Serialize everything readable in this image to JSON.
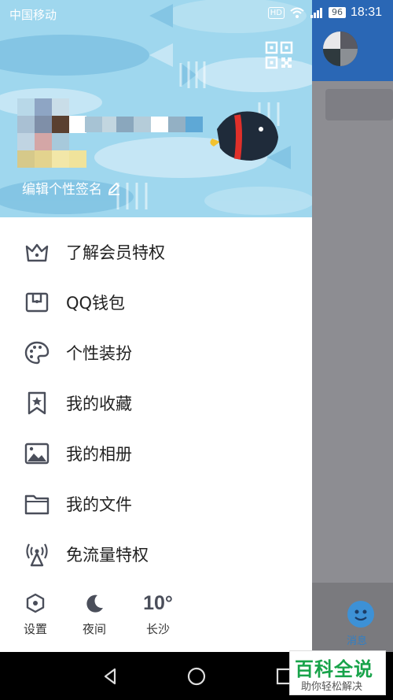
{
  "status_bar": {
    "carrier": "中国移动",
    "hd_badge": "HD",
    "battery": "96",
    "time": "18:31"
  },
  "profile": {
    "signature": "编辑个性签名"
  },
  "menu": {
    "items": [
      {
        "label": "了解会员特权",
        "icon": "crown-icon"
      },
      {
        "label": "QQ钱包",
        "icon": "wallet-icon"
      },
      {
        "label": "个性装扮",
        "icon": "palette-icon"
      },
      {
        "label": "我的收藏",
        "icon": "bookmark-star-icon"
      },
      {
        "label": "我的相册",
        "icon": "photo-icon"
      },
      {
        "label": "我的文件",
        "icon": "folder-icon"
      },
      {
        "label": "免流量特权",
        "icon": "signal-tower-icon"
      }
    ]
  },
  "bottom_bar": {
    "settings_label": "设置",
    "night_label": "夜间",
    "weather_temp": "10°",
    "weather_city": "长沙"
  },
  "background_screen": {
    "messages_tab": "消息"
  },
  "watermark": {
    "title": "百科全说",
    "subtitle": "助你轻松解决"
  },
  "colors": {
    "hero_bg": "#9fd7ee",
    "icon_gray": "#4a4e5a",
    "bg_header": "#2a67b5"
  }
}
